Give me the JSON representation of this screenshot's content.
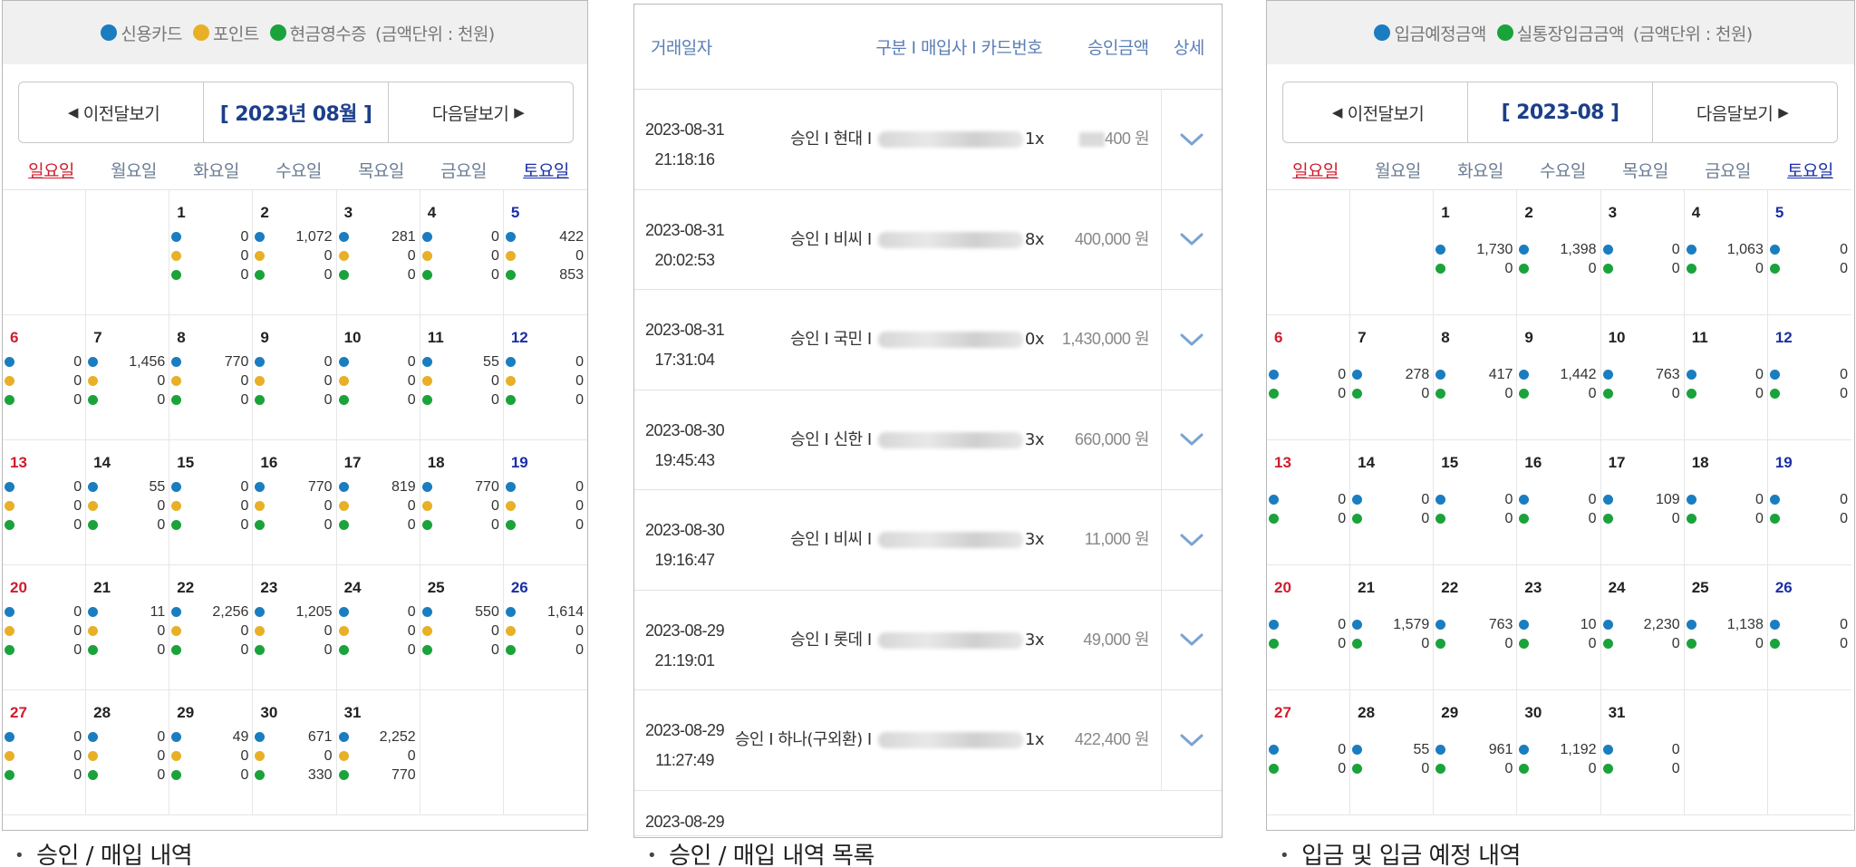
{
  "panel1": {
    "legend": [
      {
        "label": "신용카드",
        "color": "#1a7dc0"
      },
      {
        "label": "포인트",
        "color": "#e8b026"
      },
      {
        "label": "현금영수증",
        "color": "#1aa33a"
      }
    ],
    "unit": "(금액단위 : 천원)",
    "prev": "이전달보기",
    "current": "[ 2023년 08월 ]",
    "next": "다음달보기",
    "weekdays": [
      "일요일",
      "월요일",
      "화요일",
      "수요일",
      "목요일",
      "금요일",
      "토요일"
    ],
    "first_weekday": 2,
    "days": [
      [
        "0",
        "0",
        "0"
      ],
      [
        "1,072",
        "0",
        "0"
      ],
      [
        "281",
        "0",
        "0"
      ],
      [
        "0",
        "0",
        "0"
      ],
      [
        "422",
        "0",
        "853"
      ],
      [
        "0",
        "0",
        "0"
      ],
      [
        "1,456",
        "0",
        "0"
      ],
      [
        "770",
        "0",
        "0"
      ],
      [
        "0",
        "0",
        "0"
      ],
      [
        "0",
        "0",
        "0"
      ],
      [
        "55",
        "0",
        "0"
      ],
      [
        "0",
        "0",
        "0"
      ],
      [
        "0",
        "0",
        "0"
      ],
      [
        "55",
        "0",
        "0"
      ],
      [
        "0",
        "0",
        "0"
      ],
      [
        "770",
        "0",
        "0"
      ],
      [
        "819",
        "0",
        "0"
      ],
      [
        "770",
        "0",
        "0"
      ],
      [
        "0",
        "0",
        "0"
      ],
      [
        "0",
        "0",
        "0"
      ],
      [
        "11",
        "0",
        "0"
      ],
      [
        "2,256",
        "0",
        "0"
      ],
      [
        "1,205",
        "0",
        "0"
      ],
      [
        "0",
        "0",
        "0"
      ],
      [
        "550",
        "0",
        "0"
      ],
      [
        "1,614",
        "0",
        "0"
      ],
      [
        "0",
        "0",
        "0"
      ],
      [
        "0",
        "0",
        "0"
      ],
      [
        "49",
        "0",
        "0"
      ],
      [
        "671",
        "0",
        "330"
      ],
      [
        "2,252",
        "0",
        "770"
      ]
    ],
    "caption": "승인 / 매입 내역"
  },
  "panel2": {
    "headers": {
      "date": "거래일자",
      "info": "구분 I 매입사 I 카드번호",
      "amount": "승인금액",
      "detail": "상세"
    },
    "rows": [
      {
        "date": "2023-08-31",
        "time": "21:18:16",
        "type": "승인",
        "company": "현대",
        "card_tail": "1x",
        "amount_tail": "400 원",
        "amount_masked": true
      },
      {
        "date": "2023-08-31",
        "time": "20:02:53",
        "type": "승인",
        "company": "비씨",
        "card_tail": "8x",
        "amount": "400,000 원"
      },
      {
        "date": "2023-08-31",
        "time": "17:31:04",
        "type": "승인",
        "company": "국민",
        "card_tail": "0x",
        "amount": "1,430,000 원"
      },
      {
        "date": "2023-08-30",
        "time": "19:45:43",
        "type": "승인",
        "company": "신한",
        "card_tail": "3x",
        "amount": "660,000 원"
      },
      {
        "date": "2023-08-30",
        "time": "19:16:47",
        "type": "승인",
        "company": "비씨",
        "card_tail": "3x",
        "amount": "11,000 원"
      },
      {
        "date": "2023-08-29",
        "time": "21:19:01",
        "type": "승인",
        "company": "롯데",
        "card_tail": "3x",
        "amount": "49,000 원"
      },
      {
        "date": "2023-08-29",
        "time": "11:27:49",
        "type": "승인",
        "company": "하나(구외환)",
        "card_tail": "1x",
        "amount": "422,400 원"
      }
    ],
    "partial_date": "2023-08-29",
    "caption": "승인 / 매입 내역 목록"
  },
  "panel3": {
    "legend": [
      {
        "label": "입금예정금액",
        "color": "#1a7dc0"
      },
      {
        "label": "실통장입금금액",
        "color": "#1aa33a"
      }
    ],
    "unit": "(금액단위 : 천원)",
    "prev": "이전달보기",
    "current": "[ 2023-08 ]",
    "next": "다음달보기",
    "weekdays": [
      "일요일",
      "월요일",
      "화요일",
      "수요일",
      "목요일",
      "금요일",
      "토요일"
    ],
    "first_weekday": 2,
    "days": [
      [
        "1,730",
        "0"
      ],
      [
        "1,398",
        "0"
      ],
      [
        "0",
        "0"
      ],
      [
        "1,063",
        "0"
      ],
      [
        "0",
        "0"
      ],
      [
        "0",
        "0"
      ],
      [
        "278",
        "0"
      ],
      [
        "417",
        "0"
      ],
      [
        "1,442",
        "0"
      ],
      [
        "763",
        "0"
      ],
      [
        "0",
        "0"
      ],
      [
        "0",
        "0"
      ],
      [
        "0",
        "0"
      ],
      [
        "0",
        "0"
      ],
      [
        "0",
        "0"
      ],
      [
        "0",
        "0"
      ],
      [
        "109",
        "0"
      ],
      [
        "0",
        "0"
      ],
      [
        "0",
        "0"
      ],
      [
        "0",
        "0"
      ],
      [
        "1,579",
        "0"
      ],
      [
        "763",
        "0"
      ],
      [
        "10",
        "0"
      ],
      [
        "2,230",
        "0"
      ],
      [
        "1,138",
        "0"
      ],
      [
        "0",
        "0"
      ],
      [
        "0",
        "0"
      ],
      [
        "55",
        "0"
      ],
      [
        "961",
        "0"
      ],
      [
        "1,192",
        "0"
      ],
      [
        "0",
        "0"
      ]
    ],
    "caption": "입금 및 입금 예정 내역"
  }
}
